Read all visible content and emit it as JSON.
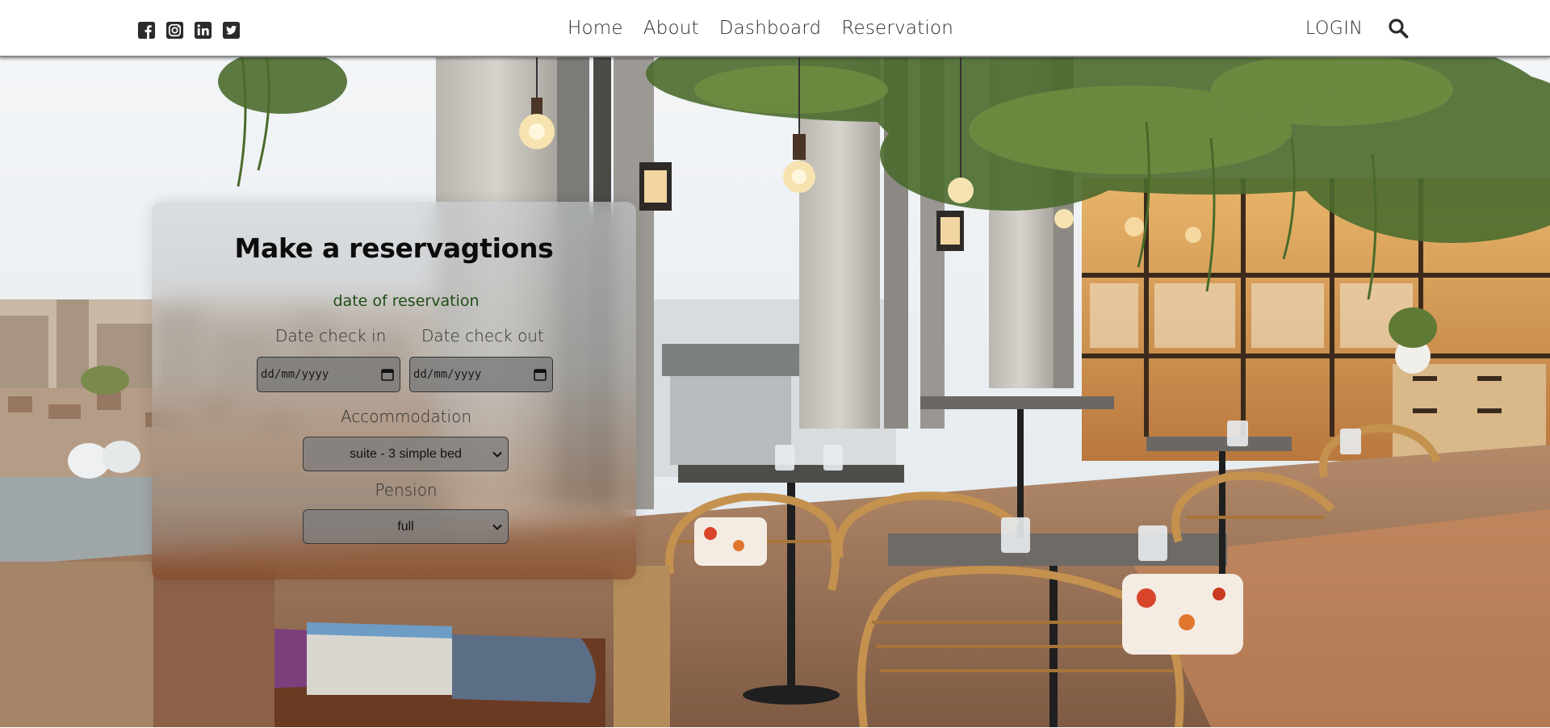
{
  "nav": {
    "social": [
      {
        "icon": "facebook-icon"
      },
      {
        "icon": "instagram-icon"
      },
      {
        "icon": "linkedin-icon"
      },
      {
        "icon": "twitter-icon"
      }
    ],
    "links": [
      "Home",
      "About",
      "Dashboard",
      "Reservation"
    ],
    "login_label": "LOGIN",
    "search_icon": "search-icon"
  },
  "hero": {
    "scene": "restaurant-interior-photo"
  },
  "reservation": {
    "title": "Make a reservagtions",
    "subtitle": "date of reservation",
    "check_in_label": "Date check in",
    "check_out_label": "Date check out",
    "check_in_value": "dd/mm/yyyy",
    "check_out_value": "dd/mm/yyyy",
    "accommodation_label": "Accommodation",
    "accommodation_selected": "suite - 3 simple bed",
    "pension_label": "Pension",
    "pension_selected": "full"
  },
  "colors": {
    "subtitle": "#1f4d17",
    "nav_text": "#2a2a2a"
  }
}
